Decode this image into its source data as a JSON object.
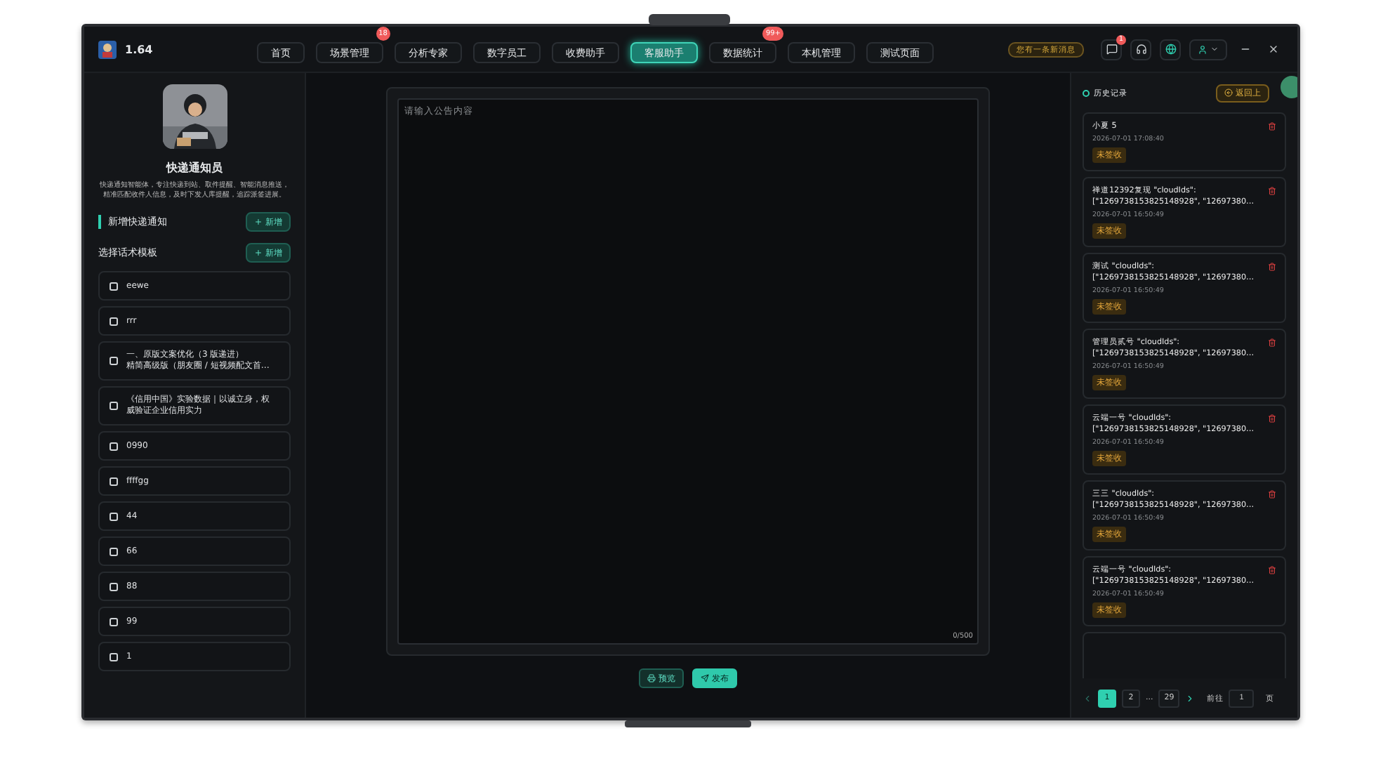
{
  "app": {
    "version": "1.64"
  },
  "nav": [
    {
      "label": "首页",
      "selected": false
    },
    {
      "label": "场景管理",
      "selected": false,
      "badge": "18"
    },
    {
      "label": "分析专家",
      "selected": false
    },
    {
      "label": "数字员工",
      "selected": false
    },
    {
      "label": "收费助手",
      "selected": false
    },
    {
      "label": "客服助手",
      "selected": true
    },
    {
      "label": "数据统计",
      "selected": false,
      "badge": "99+"
    },
    {
      "label": "本机管理",
      "selected": false
    },
    {
      "label": "测试页面",
      "selected": false
    }
  ],
  "header_right": {
    "notice": "您有一条新消息",
    "message_badge": "1"
  },
  "agent": {
    "name": "快递通知员",
    "description": "快递通知智能体，专注快递到站、取件提醒、智能消息推送，精准匹配收件人信息，及时下发人库提醒，追踪派签进展。"
  },
  "sections": [
    {
      "title": "新增快递通知",
      "button": "新增"
    },
    {
      "title": "选择话术模板",
      "button": "新增"
    }
  ],
  "templates": [
    {
      "lines": [
        "eewe"
      ],
      "checked": false
    },
    {
      "lines": [
        "rrr"
      ],
      "checked": false
    },
    {
      "lines": [
        "一、原版文案优化（3 版递进）",
        "精简高级版（朋友圈 / 短视频配文首…"
      ],
      "checked": false
    },
    {
      "lines": [
        "《信用中国》实验数据｜以诚立身，权",
        "威验证企业信用实力"
      ],
      "checked": false
    },
    {
      "lines": [
        "0990"
      ],
      "checked": false
    },
    {
      "lines": [
        "ffffgg"
      ],
      "checked": false
    },
    {
      "lines": [
        "44"
      ],
      "checked": false
    },
    {
      "lines": [
        "66"
      ],
      "checked": false
    },
    {
      "lines": [
        "88"
      ],
      "checked": false
    },
    {
      "lines": [
        "99"
      ],
      "checked": false
    },
    {
      "lines": [
        "1"
      ],
      "checked": false
    }
  ],
  "editor": {
    "placeholder": "请输入公告内容",
    "counter": "0/500"
  },
  "actions": [
    {
      "label": "预览",
      "kind": "preview"
    },
    {
      "label": "发布",
      "kind": "publish"
    }
  ],
  "history": {
    "title": "历史记录",
    "back_button": "返回上",
    "records": [
      {
        "title": "小夏 5",
        "time": "2026-07-01 17:08:40",
        "status": "未签收"
      },
      {
        "title": "禅道12392复现 \"cloudIds\":\n[\"1269738153825148928\", \"12697380…",
        "time": "2026-07-01 16:50:49",
        "status": "未签收"
      },
      {
        "title": "测试 \"cloudIds\":\n[\"1269738153825148928\", \"12697380…",
        "time": "2026-07-01 16:50:49",
        "status": "未签收"
      },
      {
        "title": "管理员贰号 \"cloudIds\":\n[\"1269738153825148928\", \"12697380…",
        "time": "2026-07-01 16:50:49",
        "status": "未签收"
      },
      {
        "title": "云端一号 \"cloudIds\":\n[\"1269738153825148928\", \"12697380…",
        "time": "2026-07-01 16:50:49",
        "status": "未签收"
      },
      {
        "title": "三三 \"cloudIds\":\n[\"1269738153825148928\", \"12697380…",
        "time": "2026-07-01 16:50:49",
        "status": "未签收"
      },
      {
        "title": "云端一号 \"cloudIds\":\n[\"1269738153825148928\", \"12697380…",
        "time": "2026-07-01 16:50:49",
        "status": "未签收"
      }
    ],
    "pagination": {
      "pages": [
        {
          "label": "1",
          "kind": "page",
          "selected": true
        },
        {
          "label": "2",
          "kind": "page",
          "selected": false
        },
        {
          "label": "...",
          "kind": "ellipsis"
        },
        {
          "label": "29",
          "kind": "page",
          "selected": false
        }
      ],
      "goto_label": "前往",
      "goto_value": "1",
      "page_unit": "页"
    }
  }
}
